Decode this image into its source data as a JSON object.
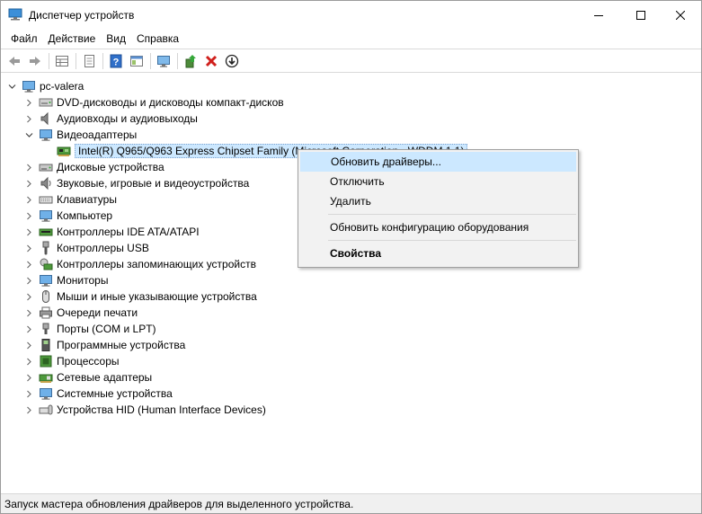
{
  "window": {
    "title": "Диспетчер устройств"
  },
  "menu": [
    "Файл",
    "Действие",
    "Вид",
    "Справка"
  ],
  "toolbar": {
    "icons": [
      "back-arrow-icon",
      "forward-arrow-icon",
      "properties-grid-icon",
      "page-icon",
      "help-icon",
      "view-icon",
      "monitor-icon",
      "update-driver-icon",
      "uninstall-x-icon",
      "download-circle-icon"
    ]
  },
  "tree": {
    "root": "pc-valera",
    "categories": [
      {
        "label": "DVD-дисководы и дисководы компакт-дисков",
        "icon": "dvd-drive-icon"
      },
      {
        "label": "Аудиовходы и аудиовыходы",
        "icon": "speaker-icon"
      },
      {
        "label": "Видеоадаптеры",
        "icon": "display-adapter-icon",
        "expanded": true,
        "children": [
          "Intel(R)  Q965/Q963 Express Chipset Family (Microsoft Corporation - WDDM 1.1)"
        ]
      },
      {
        "label": "Дисковые устройства",
        "icon": "disk-drive-icon"
      },
      {
        "label": "Звуковые, игровые и видеоустройства",
        "icon": "sound-icon"
      },
      {
        "label": "Клавиатуры",
        "icon": "keyboard-icon"
      },
      {
        "label": "Компьютер",
        "icon": "computer-icon"
      },
      {
        "label": "Контроллеры IDE ATA/ATAPI",
        "icon": "ide-controller-icon"
      },
      {
        "label": "Контроллеры USB",
        "icon": "usb-icon"
      },
      {
        "label": "Контроллеры запоминающих устройств",
        "icon": "storage-controller-icon"
      },
      {
        "label": "Мониторы",
        "icon": "monitor-icon"
      },
      {
        "label": "Мыши и иные указывающие устройства",
        "icon": "mouse-icon"
      },
      {
        "label": "Очереди печати",
        "icon": "printer-icon"
      },
      {
        "label": "Порты (COM и LPT)",
        "icon": "port-icon"
      },
      {
        "label": "Программные устройства",
        "icon": "software-device-icon"
      },
      {
        "label": "Процессоры",
        "icon": "processor-icon"
      },
      {
        "label": "Сетевые адаптеры",
        "icon": "network-adapter-icon"
      },
      {
        "label": "Системные устройства",
        "icon": "system-device-icon"
      },
      {
        "label": "Устройства HID (Human Interface Devices)",
        "icon": "hid-icon"
      }
    ]
  },
  "context_menu": {
    "items": [
      {
        "label": "Обновить драйверы...",
        "highlighted": true
      },
      {
        "label": "Отключить"
      },
      {
        "label": "Удалить"
      },
      {
        "label": "Обновить конфигурацию оборудования"
      },
      {
        "label": "Свойства",
        "bold": true
      }
    ]
  },
  "status": "Запуск мастера обновления драйверов для выделенного устройства.",
  "colors": {
    "selection": "#cce8ff",
    "menu_bg": "#f2f2f2",
    "accent_blue": "#1e6fc0",
    "delete_red": "#d0201c"
  }
}
